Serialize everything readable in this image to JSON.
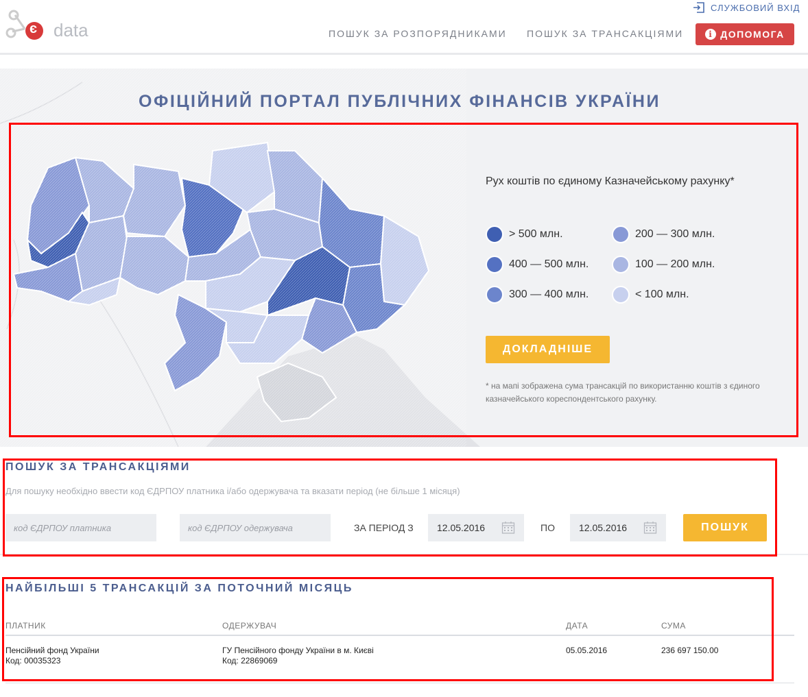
{
  "header": {
    "logo_text": "data",
    "logo_letter": "є",
    "login_label": "СЛУЖБОВИЙ ВХІД",
    "nav_items": [
      "ПОШУК ЗА РОЗПОРЯДНИКАМИ",
      "ПОШУК ЗА ТРАНСАКЦІЯМИ"
    ],
    "help_label": "ДОПОМОГА"
  },
  "hero": {
    "title": "ОФІЦІЙНИЙ ПОРТАЛ ПУБЛІЧНИХ ФІНАНСІВ УКРАЇНИ",
    "legend_title": "Рух коштів по єдиному Казначейському рахунку*",
    "legend": [
      {
        "label": "> 500 млн.",
        "color": "#3f5fb2"
      },
      {
        "label": "200 — 300 млн.",
        "color": "#8899d6"
      },
      {
        "label": "400 — 500 млн.",
        "color": "#5471c2"
      },
      {
        "label": "100 — 200 млн.",
        "color": "#a9b6e2"
      },
      {
        "label": "300 — 400 млн.",
        "color": "#6c85cc"
      },
      {
        "label": "< 100 млн.",
        "color": "#c7d0ee"
      }
    ],
    "more_label": "ДОКЛАДНІШЕ",
    "note": "* на мапі зображена сума трансакцій по використанню коштів з єдиного казначейського кореспондентського рахунку."
  },
  "search": {
    "title": "ПОШУК ЗА ТРАНСАКЦІЯМИ",
    "hint": "Для пошуку необхідно ввести код ЄДРПОУ платника і/або одержувача та вказати період (не більше 1 місяця)",
    "payer_placeholder": "код ЄДРПОУ платника",
    "receiver_placeholder": "код ЄДРПОУ одержувача",
    "period_from_label": "ЗА ПЕРІОД З",
    "date_from": "12.05.2016",
    "to_label": "ПО",
    "date_to": "12.05.2016",
    "search_label": "ПОШУК"
  },
  "top": {
    "title": "НАЙБІЛЬШІ 5 ТРАНСАКЦІЙ ЗА ПОТОЧНИЙ МІСЯЦЬ",
    "columns": [
      "ПЛАТНИК",
      "ОДЕРЖУВАЧ",
      "ДАТА",
      "СУМА"
    ],
    "rows": [
      {
        "payer": "Пенсійний фонд України",
        "payer_code": "Код: 00035323",
        "receiver": "ГУ Пенсійного фонду України в м. Києві",
        "receiver_code": "Код: 22869069",
        "date": "05.05.2016",
        "amount": "236 697 150.00"
      }
    ]
  },
  "colors": {
    "accent_yellow": "#f5b731",
    "help_red": "#d64545",
    "title_blue": "#576a9a"
  }
}
